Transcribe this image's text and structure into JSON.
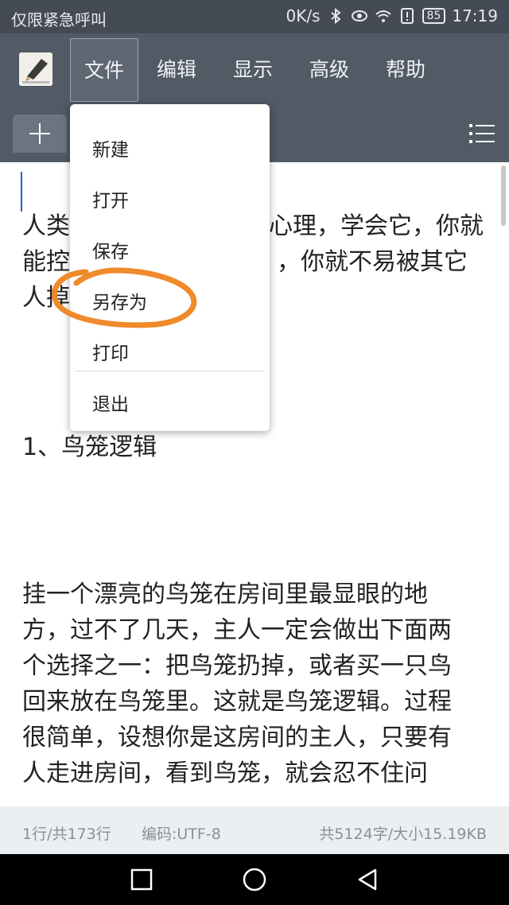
{
  "status_bar": {
    "carrier": "仅限紧急呼叫",
    "network_speed": "0K/s",
    "battery": "85",
    "time": "17:19"
  },
  "toolbar": {
    "menu": [
      {
        "label": "文件",
        "active": true
      },
      {
        "label": "编辑",
        "active": false
      },
      {
        "label": "显示",
        "active": false
      },
      {
        "label": "高级",
        "active": false
      },
      {
        "label": "帮助",
        "active": false
      }
    ]
  },
  "file_menu": {
    "items": [
      "新建",
      "打开",
      "保存",
      "另存为",
      "打印",
      "退出"
    ],
    "highlighted": "另存为"
  },
  "document": {
    "lines": [
      "人类",
      "心理，学会它，你就",
      "能控",
      "，你就不易被其它",
      "人掉",
      "1、鸟笼逻辑",
      "挂一个漂亮的鸟笼在房间里最显眼的地",
      "方，过不了几天，主人一定会做出下面两",
      "个选择之一：把鸟笼扔掉，或者买一只鸟",
      "回来放在鸟笼里。这就是鸟笼逻辑。过程",
      "很简单，设想你是这房间的主人，只要有",
      "人走进房间，看到鸟笼，就会忍不住问"
    ]
  },
  "footer": {
    "line_info": "1行/共173行",
    "encoding": "编码:UTF-8",
    "size_info": "共5124字/大小15.19KB"
  },
  "colors": {
    "toolbar_bg": "#515a65",
    "status_bg": "#444b55",
    "annotation": "#f08a2a"
  }
}
